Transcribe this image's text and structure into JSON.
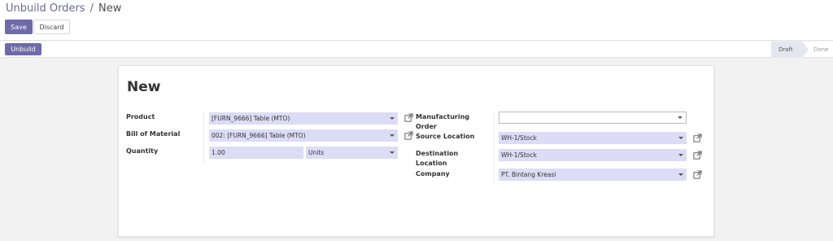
{
  "breadcrumb": {
    "parent": "Unbuild Orders",
    "separator": "/",
    "current": "New"
  },
  "buttons": {
    "save": "Save",
    "discard": "Discard",
    "unbuild": "Unbuild"
  },
  "status": {
    "steps": [
      "Draft",
      "Done"
    ],
    "active": "Draft"
  },
  "form": {
    "title": "New",
    "product_label": "Product",
    "product_value": "[FURN_9666] Table (MTO)",
    "bom_label": "Bill of Material",
    "bom_value": "002: [FURN_9666] Table (MTO)",
    "quantity_label": "Quantity",
    "quantity_value": "1.00",
    "uom_value": "Units",
    "mo_label": "Manufacturing Order",
    "mo_value": "",
    "source_label": "Source Location",
    "source_value": "WH-1/Stock",
    "dest_label": "Destination Location",
    "dest_value": "WH-1/Stock",
    "company_label": "Company",
    "company_value": "PT. Bintang Kreasi"
  },
  "icons": {
    "external_link": "external-link-icon",
    "dropdown": "caret-down-icon"
  },
  "colors": {
    "primary": "#6f6aa8",
    "field_bg": "#dcdcf6",
    "status_active": "#e4e7ee"
  }
}
